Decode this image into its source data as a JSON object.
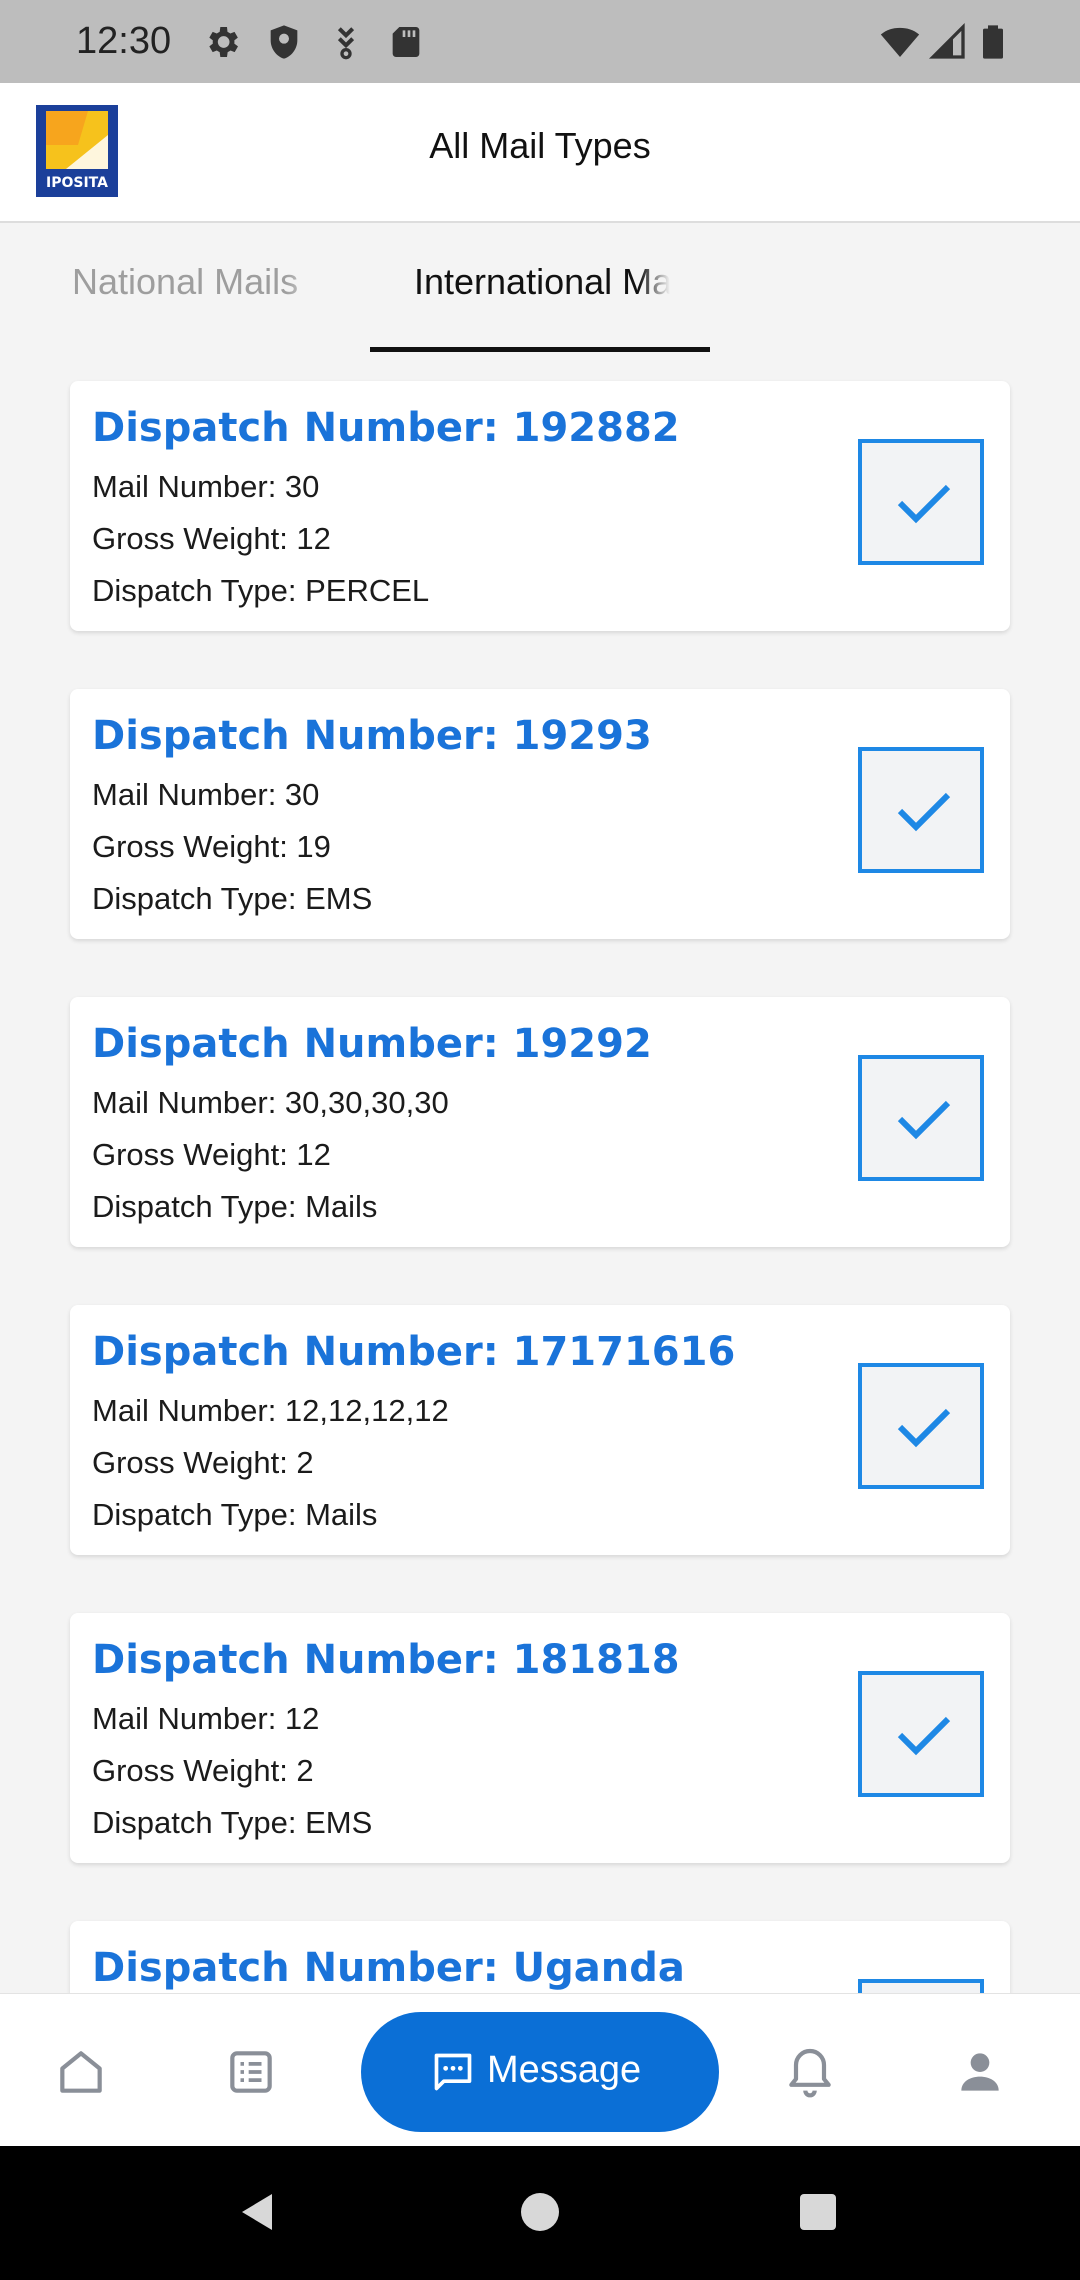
{
  "status_bar": {
    "time": "12:30",
    "left_icons": [
      "gear-icon",
      "shield-icon",
      "download-icon",
      "sd-card-icon"
    ],
    "right_icons": [
      "wifi-icon",
      "signal-icon",
      "battery-icon"
    ]
  },
  "app_bar": {
    "logo_text": "IPOSITA",
    "title": "All Mail Types"
  },
  "tabs": [
    {
      "label": "National Mails",
      "selected": false
    },
    {
      "label": "International Mails",
      "selected": true
    }
  ],
  "dispatches": [
    {
      "title": "Dispatch Number: 192882",
      "mail": "Mail Number: 30",
      "weight": "Gross Weight: 12",
      "type": "Dispatch Type: PERCEL",
      "checked": true
    },
    {
      "title": "Dispatch Number: 19293",
      "mail": "Mail Number: 30",
      "weight": "Gross Weight: 19",
      "type": "Dispatch Type: EMS",
      "checked": true
    },
    {
      "title": "Dispatch Number: 19292",
      "mail": "Mail Number: 30,30,30,30",
      "weight": "Gross Weight: 12",
      "type": "Dispatch Type: Mails",
      "checked": true
    },
    {
      "title": "Dispatch Number: 17171616",
      "mail": "Mail Number: 12,12,12,12",
      "weight": "Gross Weight: 2",
      "type": "Dispatch Type: Mails",
      "checked": true
    },
    {
      "title": "Dispatch Number: 181818",
      "mail": "Mail Number: 12",
      "weight": "Gross Weight: 2",
      "type": "Dispatch Type: EMS",
      "checked": true
    },
    {
      "title": "Dispatch Number: Uganda",
      "mail": "",
      "weight": "",
      "type": "",
      "checked": true
    }
  ],
  "bottom_nav": {
    "items": [
      "home-icon",
      "list-icon",
      "message-icon",
      "bell-icon",
      "person-icon"
    ],
    "message_label": "Message"
  },
  "colors": {
    "accent": "#1a73d9",
    "button": "#0b6fd6",
    "status_bar": "#bdbdbd",
    "background": "#f4f4f4"
  }
}
